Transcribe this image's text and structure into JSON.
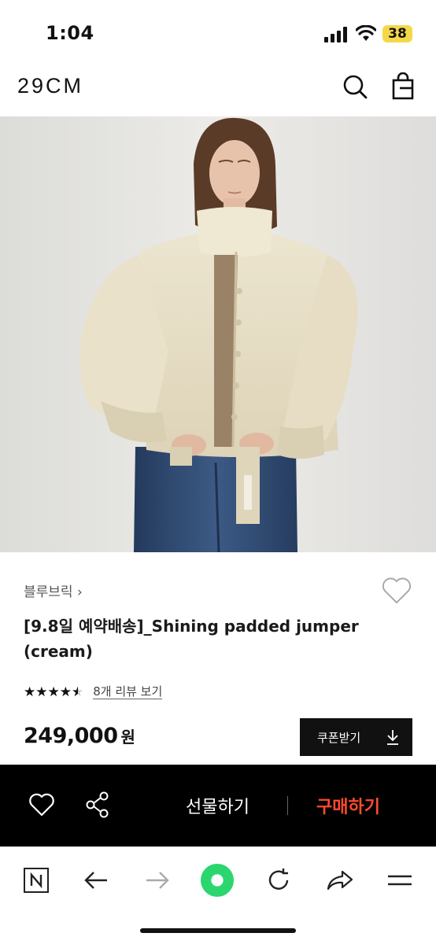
{
  "status_bar": {
    "time": "1:04",
    "battery": "38"
  },
  "header": {
    "logo": "29CM",
    "icons": [
      "search-icon",
      "shopping-bag-icon"
    ]
  },
  "product": {
    "brand": "블루브릭 ›",
    "title": "[9.8일 예약배송]_Shining padded jumper (cream)",
    "rating": 4.5,
    "stars": "★★★★★",
    "review_link": "8개 리뷰 보기",
    "price": "249,000",
    "price_unit": "원",
    "coupon_label": "쿠폰받기"
  },
  "action_bar": {
    "gift_label": "선물하기",
    "buy_label": "구매하기",
    "buy_color": "#ff4a2e"
  },
  "browser_bar": {
    "icons": [
      "naver-n-icon",
      "back-arrow-icon",
      "forward-arrow-icon",
      "home-green-icon",
      "reload-icon",
      "share-arrow-icon",
      "menu-icon"
    ],
    "accent": "#2bd66f"
  }
}
